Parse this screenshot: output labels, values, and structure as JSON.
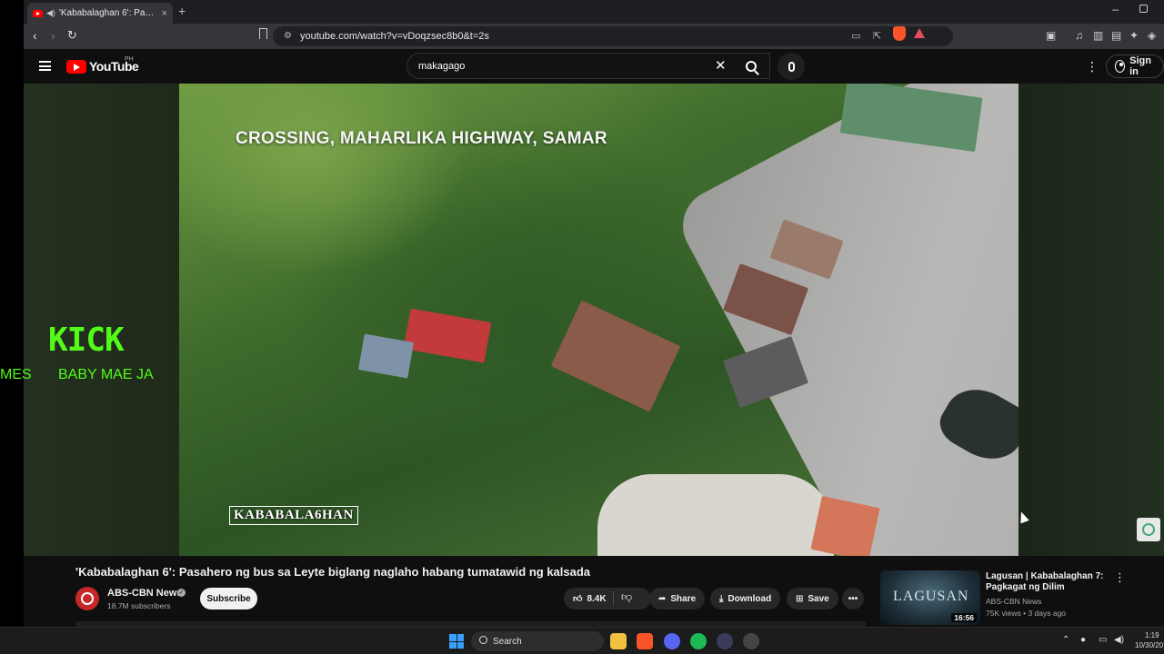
{
  "browser": {
    "tab_title": "'Kababalaghan 6': Pasahero ng",
    "tab_close": "×",
    "new_tab": "+",
    "minimize": "–",
    "url": "youtube.com/watch?v=vDoqzsec8b0&t=2s"
  },
  "masthead": {
    "logo_text": "YouTube",
    "country_code": "PH",
    "search_value": "makagago",
    "search_clear": "✕",
    "more": "⋮",
    "signin_label": "Sign in"
  },
  "video": {
    "caption": "CROSSING, MAHARLIKA HIGHWAY, SAMAR",
    "watermark": "KABABALA6HAN",
    "overlay_kick": "KICK",
    "overlay_left": "MES",
    "overlay_name": "BABY MAE JA"
  },
  "details": {
    "title": "'Kababalaghan 6': Pasahero ng bus sa Leyte biglang naglaho habang tumatawid ng kalsada",
    "channel_name": "ABS-CBN News",
    "subscribers": "18.7M subscribers",
    "subscribe_label": "Subscribe",
    "like_count": "8.4K",
    "share_label": "Share",
    "download_label": "Download",
    "save_label": "Save"
  },
  "recommendation": {
    "thumb_text": "LAGUSAN",
    "duration": "16:56",
    "title": "Lagusan | Kababalaghan 7: Pagkagat ng Dilim",
    "channel": "ABS-CBN News",
    "meta": "75K views • 3 days ago"
  },
  "taskbar": {
    "search_label": "Search",
    "time": "1:19",
    "date": "10/30/20"
  },
  "colors": {
    "youtube_red": "#ff0000",
    "kick_green": "#53fc18",
    "brave_orange": "#fb542b"
  }
}
